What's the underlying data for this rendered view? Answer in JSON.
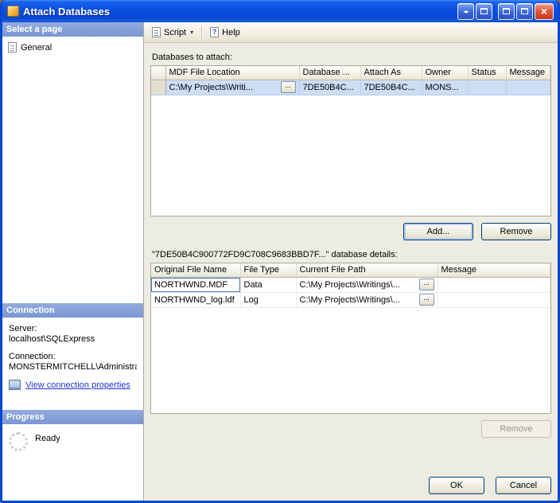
{
  "window": {
    "title": "Attach Databases"
  },
  "glyphs": {
    "dock_arrows": "◂▸",
    "close": "×",
    "caret": "▾",
    "browse": "...",
    "help_mark": "?"
  },
  "sidebar": {
    "select_page": {
      "header": "Select a page",
      "items": [
        {
          "label": "General"
        }
      ]
    },
    "connection": {
      "header": "Connection",
      "server_label": "Server:",
      "server_value": "localhost\\SQLExpress",
      "connection_label": "Connection:",
      "connection_value": "MONSTERMITCHELL\\Administra",
      "link_label": "View connection properties"
    },
    "progress": {
      "header": "Progress",
      "status": "Ready"
    }
  },
  "toolbar": {
    "script_label": "Script",
    "help_label": "Help"
  },
  "main": {
    "attach_label": "Databases to attach:",
    "attach_table": {
      "columns": [
        "MDF File Location",
        "Database ...",
        "Attach As",
        "Owner",
        "Status",
        "Message"
      ],
      "rows": [
        {
          "mdf_file_location": "C:\\My Projects\\Writi...",
          "database": "7DE50B4C...",
          "attach_as": "7DE50B4C...",
          "owner": "MONS...",
          "status": "",
          "message": ""
        }
      ]
    },
    "add_button": "Add...",
    "remove_button": "Remove",
    "details_label": "\"7DE50B4C900772FD9C708C9683BBD7F...\" database details:",
    "details_table": {
      "columns": [
        "Original File Name",
        "File Type",
        "Current File Path",
        "Message"
      ],
      "rows": [
        {
          "original_file_name": "NORTHWND.MDF",
          "file_type": "Data",
          "current_file_path": "C:\\My Projects\\Writings\\...",
          "message": ""
        },
        {
          "original_file_name": "NORTHWND_log.ldf",
          "file_type": "Log",
          "current_file_path": "C:\\My Projects\\Writings\\...",
          "message": ""
        }
      ]
    },
    "remove_details_button": "Remove",
    "ok_button": "OK",
    "cancel_button": "Cancel"
  }
}
